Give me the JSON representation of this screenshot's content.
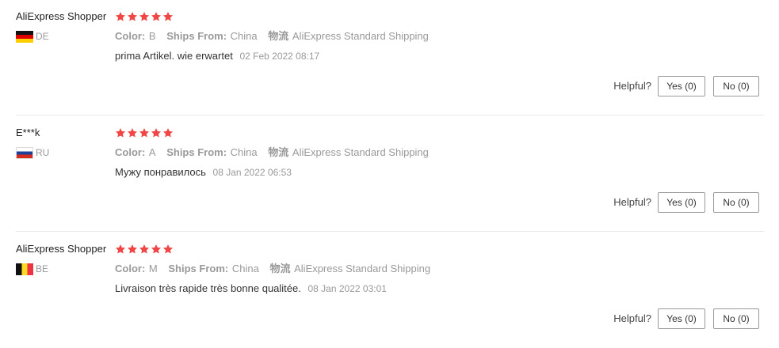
{
  "colors": {
    "star": "#f04645",
    "divider": "#e8e8e8",
    "muted_text": "#999999"
  },
  "reviews": [
    {
      "user": "AliExpress Shopper",
      "country_code": "DE",
      "flag_icon": "germany-flag-icon",
      "stars": 5,
      "color_label": "Color:",
      "color_value": "B",
      "ships_label": "Ships From:",
      "ships_value": "China",
      "logistics_label": "物流",
      "logistics_value": "AliExpress Standard Shipping",
      "text": "prima Artikel. wie erwartet",
      "date": "02 Feb 2022 08:17",
      "helpful_label": "Helpful?",
      "yes_label": "Yes (0)",
      "no_label": "No (0)"
    },
    {
      "user": "E***k",
      "country_code": "RU",
      "flag_icon": "russia-flag-icon",
      "stars": 5,
      "color_label": "Color:",
      "color_value": "A",
      "ships_label": "Ships From:",
      "ships_value": "China",
      "logistics_label": "物流",
      "logistics_value": "AliExpress Standard Shipping",
      "text": "Мужу понравилось",
      "date": "08 Jan 2022 06:53",
      "helpful_label": "Helpful?",
      "yes_label": "Yes (0)",
      "no_label": "No (0)"
    },
    {
      "user": "AliExpress Shopper",
      "country_code": "BE",
      "flag_icon": "belgium-flag-icon",
      "stars": 5,
      "color_label": "Color:",
      "color_value": "M",
      "ships_label": "Ships From:",
      "ships_value": "China",
      "logistics_label": "物流",
      "logistics_value": "AliExpress Standard Shipping",
      "text": "Livraison très rapide très bonne qualitée.",
      "date": "08 Jan 2022 03:01",
      "helpful_label": "Helpful?",
      "yes_label": "Yes (0)",
      "no_label": "No (0)"
    }
  ]
}
